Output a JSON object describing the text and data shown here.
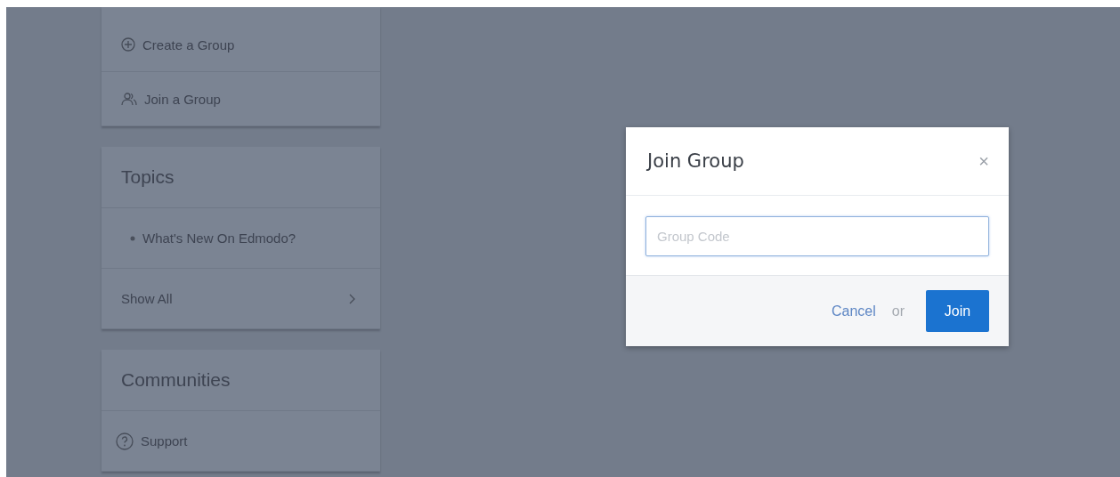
{
  "sidebar": {
    "cards": [
      {
        "items": [
          {
            "kind": "create",
            "label": "Create a Group"
          },
          {
            "kind": "join",
            "label": "Join a Group"
          }
        ]
      },
      {
        "title": "Topics",
        "items": [
          {
            "kind": "topic",
            "label": "What's New On Edmodo?"
          },
          {
            "kind": "more",
            "label": "Show All"
          }
        ]
      },
      {
        "title": "Communities",
        "items": [
          {
            "kind": "help",
            "label": "Support"
          }
        ]
      }
    ]
  },
  "dialog": {
    "title": "Join Group",
    "close": "×",
    "field": {
      "placeholder": "Group Code",
      "focused": true
    },
    "cancel": "Cancel",
    "separator": "or",
    "submit": "Join"
  }
}
